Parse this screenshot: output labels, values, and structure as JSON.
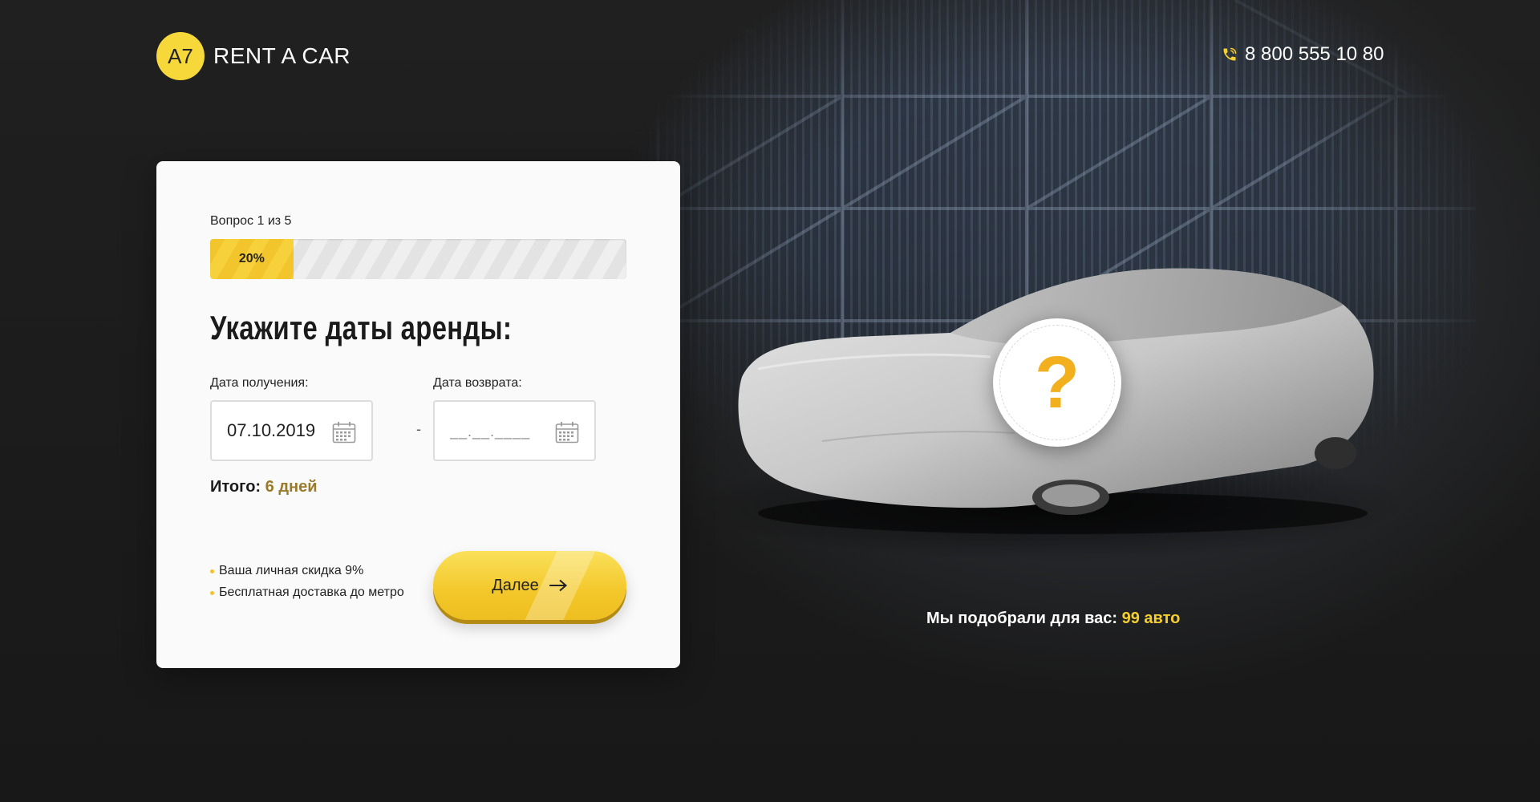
{
  "header": {
    "logo_badge": "A7",
    "logo_text": "RENT A CAR",
    "phone": "8 800 555 10 80"
  },
  "quiz": {
    "question_counter": "Вопрос 1 из 5",
    "progress_label": "20%",
    "progress_value": 0.2,
    "title": "Укажите даты аренды:",
    "pickup_label": "Дата получения:",
    "pickup_value": "07.10.2019",
    "return_label": "Дата возврата:",
    "return_placeholder": "__.__.____",
    "date_separator": "-",
    "total_label": "Итого:",
    "total_value": "6 дней",
    "bonuses": [
      "Ваша личная скидка 9%",
      "Бесплатная доставка до метро"
    ],
    "next_label": "Далее"
  },
  "preview": {
    "question_mark": "?",
    "matches_label": "Мы подобрали для вас:",
    "matches_value": "99 авто"
  },
  "colors": {
    "accent": "#f5cf2e",
    "background": "#1d1d1d",
    "card": "#fafafa",
    "total_value": "#9b7a2a"
  },
  "icons": [
    "phone-icon",
    "calendar-icon",
    "arrow-right-icon",
    "question-mark-icon"
  ]
}
